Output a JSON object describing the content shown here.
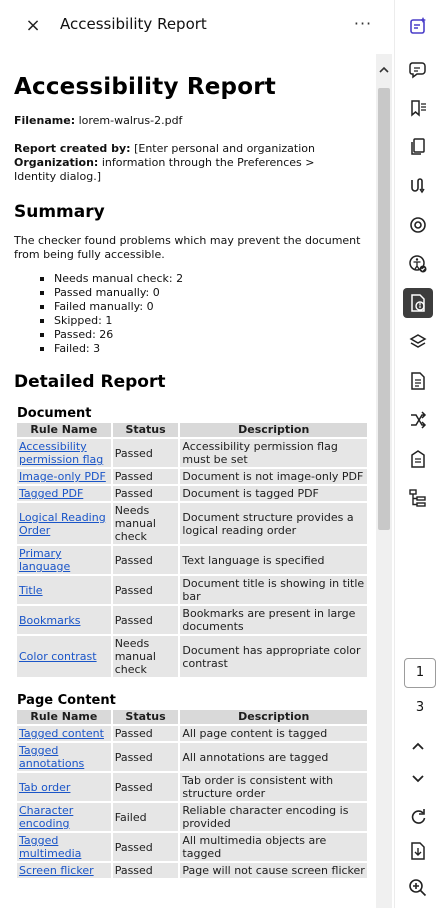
{
  "panel": {
    "close_icon": "×",
    "title": "Accessibility Report",
    "more_icon": "···"
  },
  "report": {
    "heading": "Accessibility Report",
    "filename_label": "Filename:",
    "filename_value": "lorem-walrus-2.pdf",
    "created_by_label": "Report created by:",
    "created_by_value": "[Enter personal and organization",
    "organization_label": "Organization:",
    "organization_value": "information through the Preferences >",
    "organization_value_2": "Identity dialog.]",
    "summary_heading": "Summary",
    "summary_text": "The checker found problems which may prevent the document from being fully accessible.",
    "summary_items": [
      "Needs manual check: 2",
      "Passed manually: 0",
      "Failed manually: 0",
      "Skipped: 1",
      "Passed: 26",
      "Failed: 3"
    ],
    "detailed_heading": "Detailed Report",
    "table_headers": [
      "Rule Name",
      "Status",
      "Description"
    ],
    "sections": [
      {
        "title": "Document",
        "rows": [
          {
            "rule": "Accessibility permission flag",
            "status": "Passed",
            "description": "Accessibility permission flag must be set"
          },
          {
            "rule": "Image-only PDF",
            "status": "Passed",
            "description": "Document is not image-only PDF"
          },
          {
            "rule": "Tagged PDF",
            "status": "Passed",
            "description": "Document is tagged PDF"
          },
          {
            "rule": "Logical Reading Order",
            "status": "Needs manual check",
            "description": "Document structure provides a logical reading order"
          },
          {
            "rule": "Primary language",
            "status": "Passed",
            "description": "Text language is specified"
          },
          {
            "rule": "Title",
            "status": "Passed",
            "description": "Document title is showing in title bar"
          },
          {
            "rule": "Bookmarks",
            "status": "Passed",
            "description": "Bookmarks are present in large documents"
          },
          {
            "rule": "Color contrast",
            "status": "Needs manual check",
            "description": "Document has appropriate color contrast"
          }
        ]
      },
      {
        "title": "Page Content",
        "rows": [
          {
            "rule": "Tagged content",
            "status": "Passed",
            "description": "All page content is tagged"
          },
          {
            "rule": "Tagged annotations",
            "status": "Passed",
            "description": "All annotations are tagged"
          },
          {
            "rule": "Tab order",
            "status": "Passed",
            "description": "Tab order is consistent with structure order"
          },
          {
            "rule": "Character encoding",
            "status": "Failed",
            "description": "Reliable character encoding is provided"
          },
          {
            "rule": "Tagged multimedia",
            "status": "Passed",
            "description": "All multimedia objects are tagged"
          },
          {
            "rule": "Screen flicker",
            "status": "Passed",
            "description": "Page will not cause screen flicker"
          }
        ]
      }
    ]
  },
  "toolbar": {
    "items": [
      {
        "icon": "ai-assistant-icon",
        "name": "tb-ai-assistant"
      },
      {
        "icon": "comment-icon",
        "name": "tb-comment"
      },
      {
        "icon": "bookmark-icon",
        "name": "tb-bookmarks"
      },
      {
        "icon": "pages-icon",
        "name": "tb-pages"
      },
      {
        "icon": "attachment-icon",
        "name": "tb-attachments"
      },
      {
        "icon": "target-icon",
        "name": "tb-target"
      },
      {
        "icon": "accessibility-check-icon",
        "name": "tb-accessibility-check"
      },
      {
        "icon": "accessibility-report-icon",
        "name": "tb-accessibility-report"
      },
      {
        "icon": "layers-icon",
        "name": "tb-layers"
      },
      {
        "icon": "document-icon",
        "name": "tb-document"
      },
      {
        "icon": "order-icon",
        "name": "tb-order"
      },
      {
        "icon": "content-icon",
        "name": "tb-content"
      },
      {
        "icon": "tags-tree-icon",
        "name": "tb-tags"
      }
    ],
    "current_page": "1",
    "total_pages": "3"
  }
}
